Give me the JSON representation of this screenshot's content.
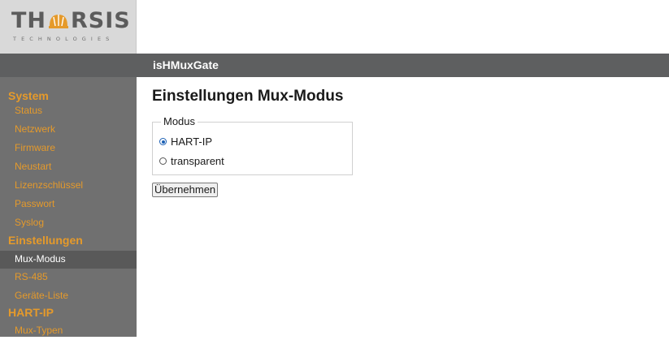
{
  "logo": {
    "main_left": "TH",
    "main_right": "RSIS",
    "sub": "TECHNOLOGIES"
  },
  "header": {
    "title": "isHMuxGate"
  },
  "sidebar": {
    "sections": [
      {
        "label": "System"
      },
      {
        "label": "Einstellungen"
      },
      {
        "label": "HART-IP"
      }
    ],
    "items": [
      {
        "label": "Status"
      },
      {
        "label": "Netzwerk"
      },
      {
        "label": "Firmware"
      },
      {
        "label": "Neustart"
      },
      {
        "label": "Lizenzschlüssel"
      },
      {
        "label": "Passwort"
      },
      {
        "label": "Syslog"
      },
      {
        "label": "Mux-Modus"
      },
      {
        "label": "RS-485"
      },
      {
        "label": "Geräte-Liste"
      },
      {
        "label": "Mux-Typen"
      }
    ],
    "active_item": "Mux-Modus"
  },
  "main": {
    "title": "Einstellungen Mux-Modus",
    "group_label": "Modus",
    "options": [
      {
        "label": "HART-IP",
        "selected": true
      },
      {
        "label": "transparent",
        "selected": false
      }
    ],
    "apply_label": "Übernehmen"
  },
  "colors": {
    "accent": "#e59a2b",
    "sidebar": "#707070",
    "header": "#5e5f60",
    "logo_bg": "#d9d9d9"
  }
}
